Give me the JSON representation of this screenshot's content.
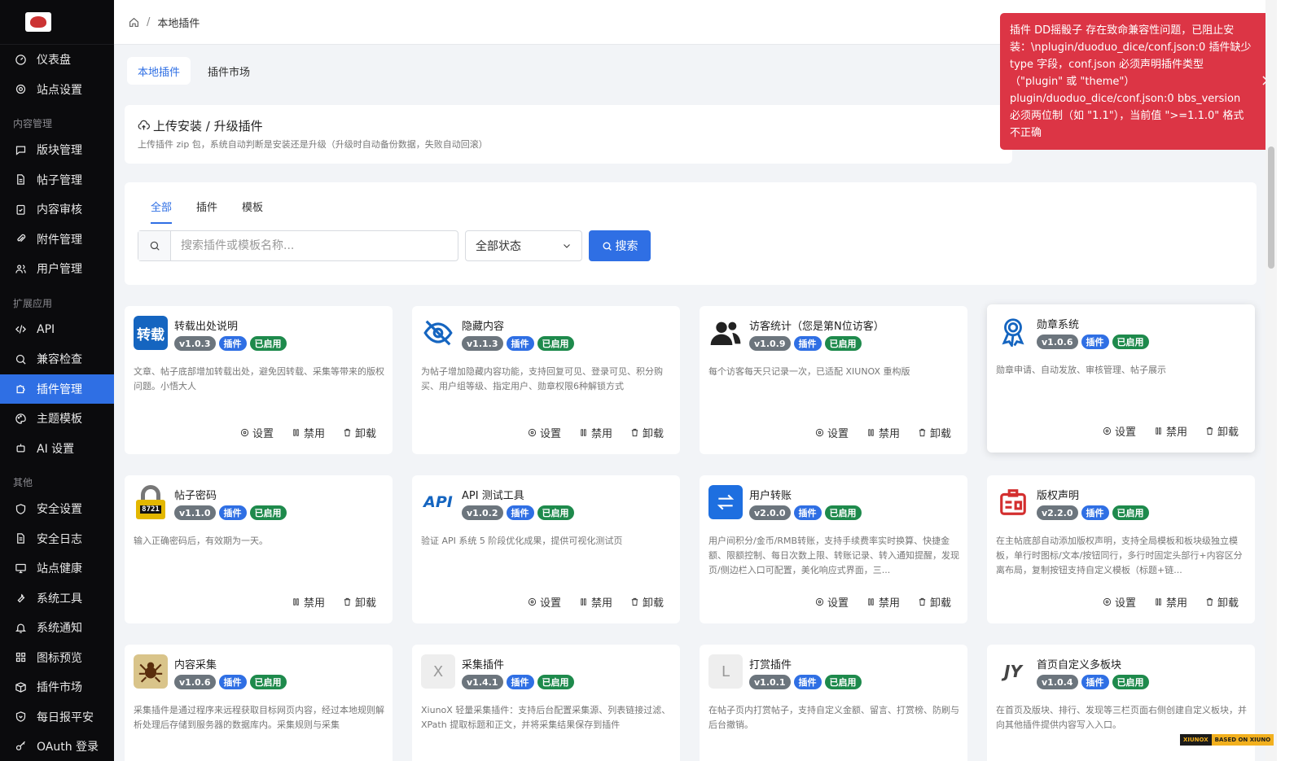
{
  "breadcrumb": {
    "current": "本地插件"
  },
  "sidebar": {
    "items": [
      {
        "label": "仪表盘",
        "icon": "dashboard-icon"
      },
      {
        "label": "站点设置",
        "icon": "gear-icon"
      },
      {
        "group": "内容管理"
      },
      {
        "label": "版块管理",
        "icon": "chat-icon"
      },
      {
        "label": "帖子管理",
        "icon": "document-icon"
      },
      {
        "label": "内容审核",
        "icon": "clipboard-check-icon"
      },
      {
        "label": "附件管理",
        "icon": "paperclip-icon"
      },
      {
        "label": "用户管理",
        "icon": "users-icon"
      },
      {
        "group": "扩展应用"
      },
      {
        "label": "API",
        "icon": "code-icon"
      },
      {
        "label": "兼容检查",
        "icon": "search-icon"
      },
      {
        "label": "插件管理",
        "icon": "puzzle-icon",
        "active": true
      },
      {
        "label": "主题模板",
        "icon": "palette-icon"
      },
      {
        "label": "AI 设置",
        "icon": "robot-icon"
      },
      {
        "group": "其他"
      },
      {
        "label": "安全设置",
        "icon": "shield-icon"
      },
      {
        "label": "安全日志",
        "icon": "log-icon"
      },
      {
        "label": "站点健康",
        "icon": "monitor-icon"
      },
      {
        "label": "系统工具",
        "icon": "wrench-icon"
      },
      {
        "label": "系统通知",
        "icon": "bell-icon"
      },
      {
        "label": "图标预览",
        "icon": "grid-icon"
      },
      {
        "label": "插件市场",
        "icon": "box-icon"
      },
      {
        "label": "每日报平安",
        "icon": "shield-heart-icon"
      },
      {
        "label": "OAuth 登录",
        "icon": "key-icon"
      }
    ]
  },
  "top_tabs": [
    {
      "label": "本地插件",
      "active": true
    },
    {
      "label": "插件市场",
      "active": false
    }
  ],
  "upload": {
    "title": "上传安装 / 升级插件",
    "desc": "上传插件 zip 包，系统自动判断是安装还是升级（升级时自动备份数据，失败自动回滚）"
  },
  "filter": {
    "tabs": [
      {
        "label": "全部",
        "active": true
      },
      {
        "label": "插件",
        "active": false
      },
      {
        "label": "模板",
        "active": false
      }
    ],
    "search_placeholder": "搜索插件或模板名称...",
    "status_value": "全部状态",
    "search_button": "搜索"
  },
  "actions": {
    "settings": "设置",
    "disable": "禁用",
    "uninstall": "卸载"
  },
  "plugins": [
    {
      "name": "转载出处说明",
      "version": "v1.0.3",
      "type": "插件",
      "status": "已启用",
      "desc": "文章、帖子底部增加转载出处，避免因转载、采集等带来的版权问题。小悟大人",
      "icon_text": "转载",
      "icon_color": "#1565c0",
      "has_settings": true
    },
    {
      "name": "隐藏内容",
      "version": "v1.1.3",
      "type": "插件",
      "status": "已启用",
      "desc": "为帖子增加隐藏内容功能，支持回复可见、登录可见、积分购买、用户组等级、指定用户、勋章权限6种解锁方式",
      "icon_text": "",
      "icon_color": "#1565c0",
      "has_settings": true
    },
    {
      "name": "访客统计（您是第N位访客）",
      "version": "v1.0.9",
      "type": "插件",
      "status": "已启用",
      "desc": "每个访客每天只记录一次，已适配 XIUNOX 重构版",
      "icon_text": "",
      "icon_color": "#222222",
      "has_settings": true
    },
    {
      "name": "勋章系统",
      "version": "v1.0.6",
      "type": "插件",
      "status": "已启用",
      "desc": "勋章申请、自动发放、审核管理、帖子展示",
      "icon_text": "",
      "icon_color": "#1565c0",
      "has_settings": true
    },
    {
      "name": "帖子密码",
      "version": "v1.1.0",
      "type": "插件",
      "status": "已启用",
      "desc": "输入正确密码后，有效期为一天。",
      "icon_text": "8721",
      "icon_color": "#e0b000",
      "has_settings": false
    },
    {
      "name": "API 测试工具",
      "version": "v1.0.2",
      "type": "插件",
      "status": "已启用",
      "desc": "验证 API 系统 5 阶段优化成果，提供可视化测试页",
      "icon_text": "API",
      "icon_color": "#1565c0",
      "has_settings": true
    },
    {
      "name": "用户转账",
      "version": "v2.0.0",
      "type": "插件",
      "status": "已启用",
      "desc": "用户间积分/金币/RMB转账，支持手续费率实时换算、快捷金额、限额控制、每日次数上限、转账记录、转入通知提醒，发现页/侧边栏入口可配置，美化响应式界面，三...",
      "icon_text": "",
      "icon_color": "#1e6fe0",
      "has_settings": true
    },
    {
      "name": "版权声明",
      "version": "v2.2.0",
      "type": "插件",
      "status": "已启用",
      "desc": "在主帖底部自动添加版权声明，支持全局模板和板块级独立模板，单行时图标/文本/按钮同行，多行时固定头部行+内容区分离布局，复制按钮支持自定义模板（标题+链...",
      "icon_text": "",
      "icon_color": "#d32f2f",
      "has_settings": true
    },
    {
      "name": "内容采集",
      "version": "v1.0.6",
      "type": "插件",
      "status": "已启用",
      "desc": "采集插件是通过程序来远程获取目标网页内容，经过本地规则解析处理后存储到服务器的数据库内。采集规则与采集",
      "icon_text": "",
      "icon_color": "#b58a3c",
      "has_settings": true
    },
    {
      "name": "采集插件",
      "version": "v1.4.1",
      "type": "插件",
      "status": "已启用",
      "desc": "XiunoX 轻量采集插件：支持后台配置采集源、列表链接过滤、XPath 提取标题和正文，并将采集结果保存到插件",
      "icon_text": "X",
      "icon_color": "#eeeeee",
      "has_settings": true
    },
    {
      "name": "打赏插件",
      "version": "v1.0.1",
      "type": "插件",
      "status": "已启用",
      "desc": "在帖子页内打赏帖子，支持自定义金额、留言、打赏榜、防刷与后台撤销。",
      "icon_text": "L",
      "icon_color": "#eeeeee",
      "has_settings": true
    },
    {
      "name": "首页自定义多板块",
      "version": "v1.0.4",
      "type": "插件",
      "status": "已启用",
      "desc": "在首页及版块、排行、发现等三栏页面右侧创建自定义板块，并向其他插件提供内容写入入口。",
      "icon_text": "JY",
      "icon_color": "#ffffff",
      "has_settings": true
    }
  ],
  "toast": {
    "message": "插件 DD摇骰子 存在致命兼容性问题，已阻止安装：\\nplugin/duoduo_dice/conf.json:0 插件缺少 type 字段，conf.json 必须声明插件类型（\"plugin\" 或 \"theme\"）plugin/duoduo_dice/conf.json:0 bbs_version 必须两位制（如 \"1.1\"），当前值 \">=1.1.0\" 格式不正确",
    "color": "#dc3545"
  },
  "footer_badge": {
    "left": "XIUNOX",
    "right": "BASED ON XIUNO"
  }
}
